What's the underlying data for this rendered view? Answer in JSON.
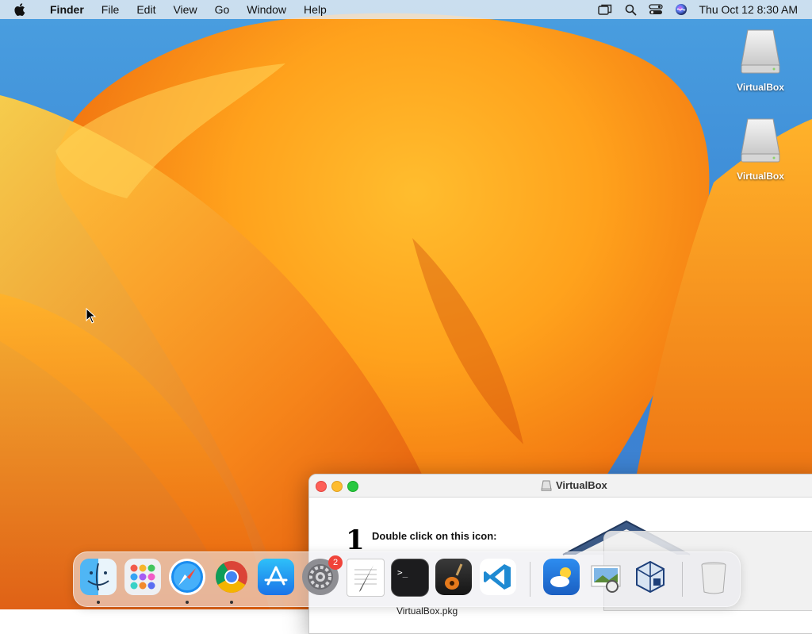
{
  "menubar": {
    "app_name": "Finder",
    "menus": [
      "File",
      "Edit",
      "View",
      "Go",
      "Window",
      "Help"
    ],
    "clock": "Thu Oct 12  8:30 AM",
    "status_icons": [
      "screen-mirroring-icon",
      "search-icon",
      "control-center-icon",
      "siri-icon"
    ]
  },
  "desktop": {
    "icons": [
      {
        "label": "VirtualBox",
        "icon": "external-drive-icon"
      },
      {
        "label": "VirtualBox",
        "icon": "external-drive-icon"
      }
    ]
  },
  "finder_window": {
    "title": "VirtualBox",
    "step_number": "1",
    "step_text": "Double click on this icon:",
    "package_label": "VirtualBox.pkg"
  },
  "dock": {
    "apps": [
      {
        "name": "Finder",
        "icon": "finder-icon",
        "running": true
      },
      {
        "name": "Launchpad",
        "icon": "launchpad-icon",
        "running": false
      },
      {
        "name": "Safari",
        "icon": "safari-icon",
        "running": true
      },
      {
        "name": "Google Chrome",
        "icon": "chrome-icon",
        "running": true
      },
      {
        "name": "App Store",
        "icon": "app-store-icon",
        "running": false
      },
      {
        "name": "System Settings",
        "icon": "settings-icon",
        "running": false,
        "badge": "2"
      },
      {
        "name": "TextEdit",
        "icon": "textedit-icon",
        "running": false
      },
      {
        "name": "Terminal",
        "icon": "terminal-icon",
        "running": false
      },
      {
        "name": "GarageBand",
        "icon": "garageband-icon",
        "running": false
      },
      {
        "name": "Visual Studio Code",
        "icon": "vscode-icon",
        "running": false
      },
      {
        "name": "Weather",
        "icon": "weather-icon",
        "running": false
      },
      {
        "name": "Preview",
        "icon": "preview-icon",
        "running": false
      },
      {
        "name": "VirtualBox",
        "icon": "virtualbox-icon",
        "running": false
      },
      {
        "name": "Trash",
        "icon": "trash-icon",
        "running": false
      }
    ]
  }
}
